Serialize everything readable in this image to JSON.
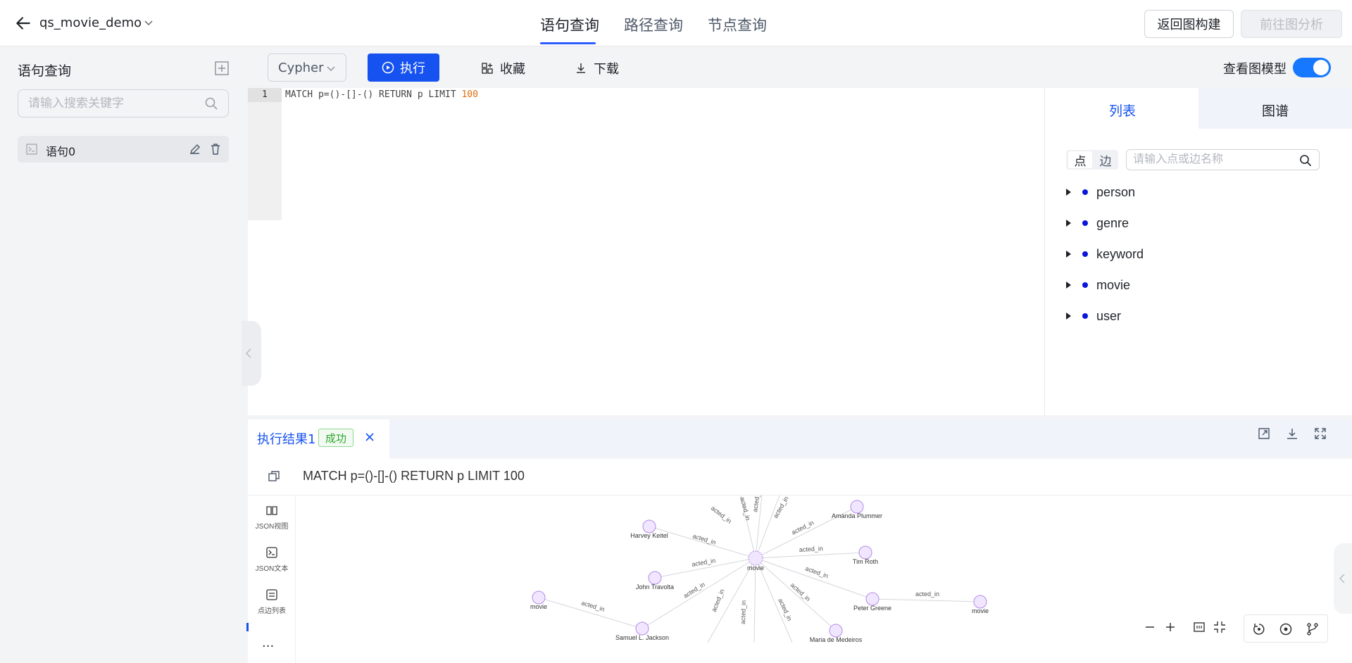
{
  "header": {
    "project_name": "qs_movie_demo",
    "tabs": [
      {
        "label": "语句查询",
        "active": true
      },
      {
        "label": "路径查询",
        "active": false
      },
      {
        "label": "节点查询",
        "active": false
      }
    ],
    "back_build_label": "返回图构建",
    "go_analysis_label": "前往图分析"
  },
  "sidebar": {
    "title": "语句查询",
    "search_placeholder": "请输入搜索关键字",
    "items": [
      {
        "label": "语句0"
      }
    ]
  },
  "toolbar": {
    "language": "Cypher",
    "execute_label": "执行",
    "favorite_label": "收藏",
    "download_label": "下载",
    "toggle_label": "查看图模型",
    "toggle_on": true
  },
  "editor": {
    "line_number": "1",
    "code_prefix": "MATCH p=()-[]-() RETURN p LIMIT ",
    "code_number": "100"
  },
  "right_panel": {
    "tabs": [
      {
        "label": "列表",
        "active": true
      },
      {
        "label": "图谱",
        "active": false
      }
    ],
    "segment": [
      "点",
      "边"
    ],
    "search_placeholder": "请输入点或边名称",
    "tree": [
      {
        "label": "person"
      },
      {
        "label": "genre"
      },
      {
        "label": "keyword"
      },
      {
        "label": "movie"
      },
      {
        "label": "user"
      }
    ]
  },
  "result": {
    "tab_title": "执行结果1",
    "status": "成功",
    "query": "MATCH p=()-[]-() RETURN p LIMIT 100",
    "views": [
      {
        "label": "JSON视图"
      },
      {
        "label": "JSON文本"
      },
      {
        "label": "点边列表"
      }
    ],
    "more": "···"
  },
  "graph": {
    "center": "movie",
    "edge_label": "acted_in",
    "nodes": [
      "Harvey Keitel",
      "John Travolta",
      "Samuel L. Jackson",
      "Amanda Plummer",
      "Tim Roth",
      "Peter Greene",
      "Maria de Medeiros",
      "movie",
      "movie"
    ],
    "colors": {
      "node_fill": "#f1e6ff",
      "node_stroke": "#b48ae8",
      "edge": "#d3d6dc"
    }
  },
  "colors": {
    "primary": "#1652f0",
    "toggle": "#1677ff",
    "success": "#2fa52f"
  }
}
